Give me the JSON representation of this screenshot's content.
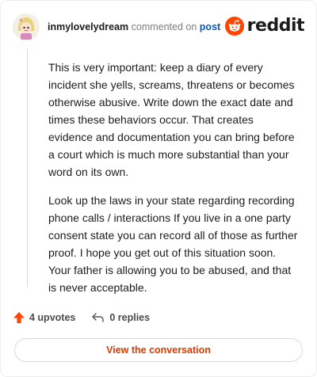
{
  "comment": {
    "username": "inmylovelydream",
    "action_text": "commented on",
    "post_link_text": "post",
    "paragraphs": [
      "This is very important: keep a diary of every incident she yells, screams, threatens or becomes otherwise abusive. Write down the exact date and times these behaviors occur. That creates evidence and documentation you can bring before a court which is much more substantial than your word on its own.",
      "Look up the laws in your state regarding recording phone calls / interactions If you live in a one party consent state you can record all of those as further proof. I hope you get out of this situation soon. Your father is allowing you to be abused, and that is never acceptable."
    ]
  },
  "brand": {
    "name": "reddit",
    "color": "#ff4500"
  },
  "footer": {
    "upvotes_label": "4 upvotes",
    "replies_label": "0 replies",
    "upvote_icon": "upvote-arrow-icon",
    "reply_icon": "reply-arrow-icon",
    "upvote_color": "#ff4500"
  },
  "cta": {
    "label": "View the conversation",
    "color": "#d93a00"
  }
}
